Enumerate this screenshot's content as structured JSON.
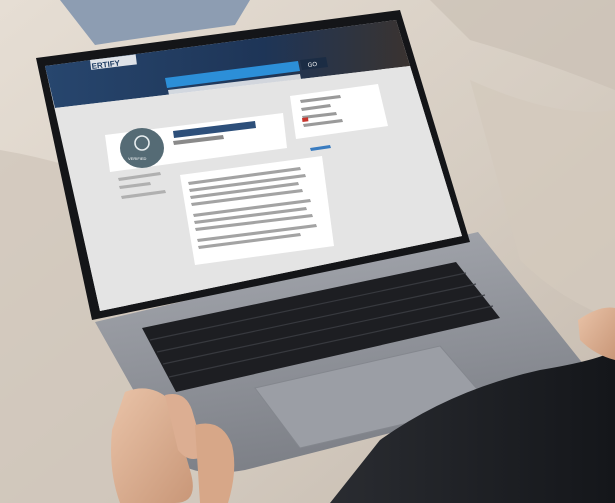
{
  "screen_site": {
    "logo_text": "ERTIFY",
    "search_button_label": "GO",
    "badge_caption": "VERIFIED"
  },
  "colors": {
    "couch": "#d9d1c7",
    "laptop_body": "#8c8f96",
    "site_header": "#1f3d63",
    "search_bar": "#2c8fd8",
    "accent_red": "#c8352d"
  }
}
